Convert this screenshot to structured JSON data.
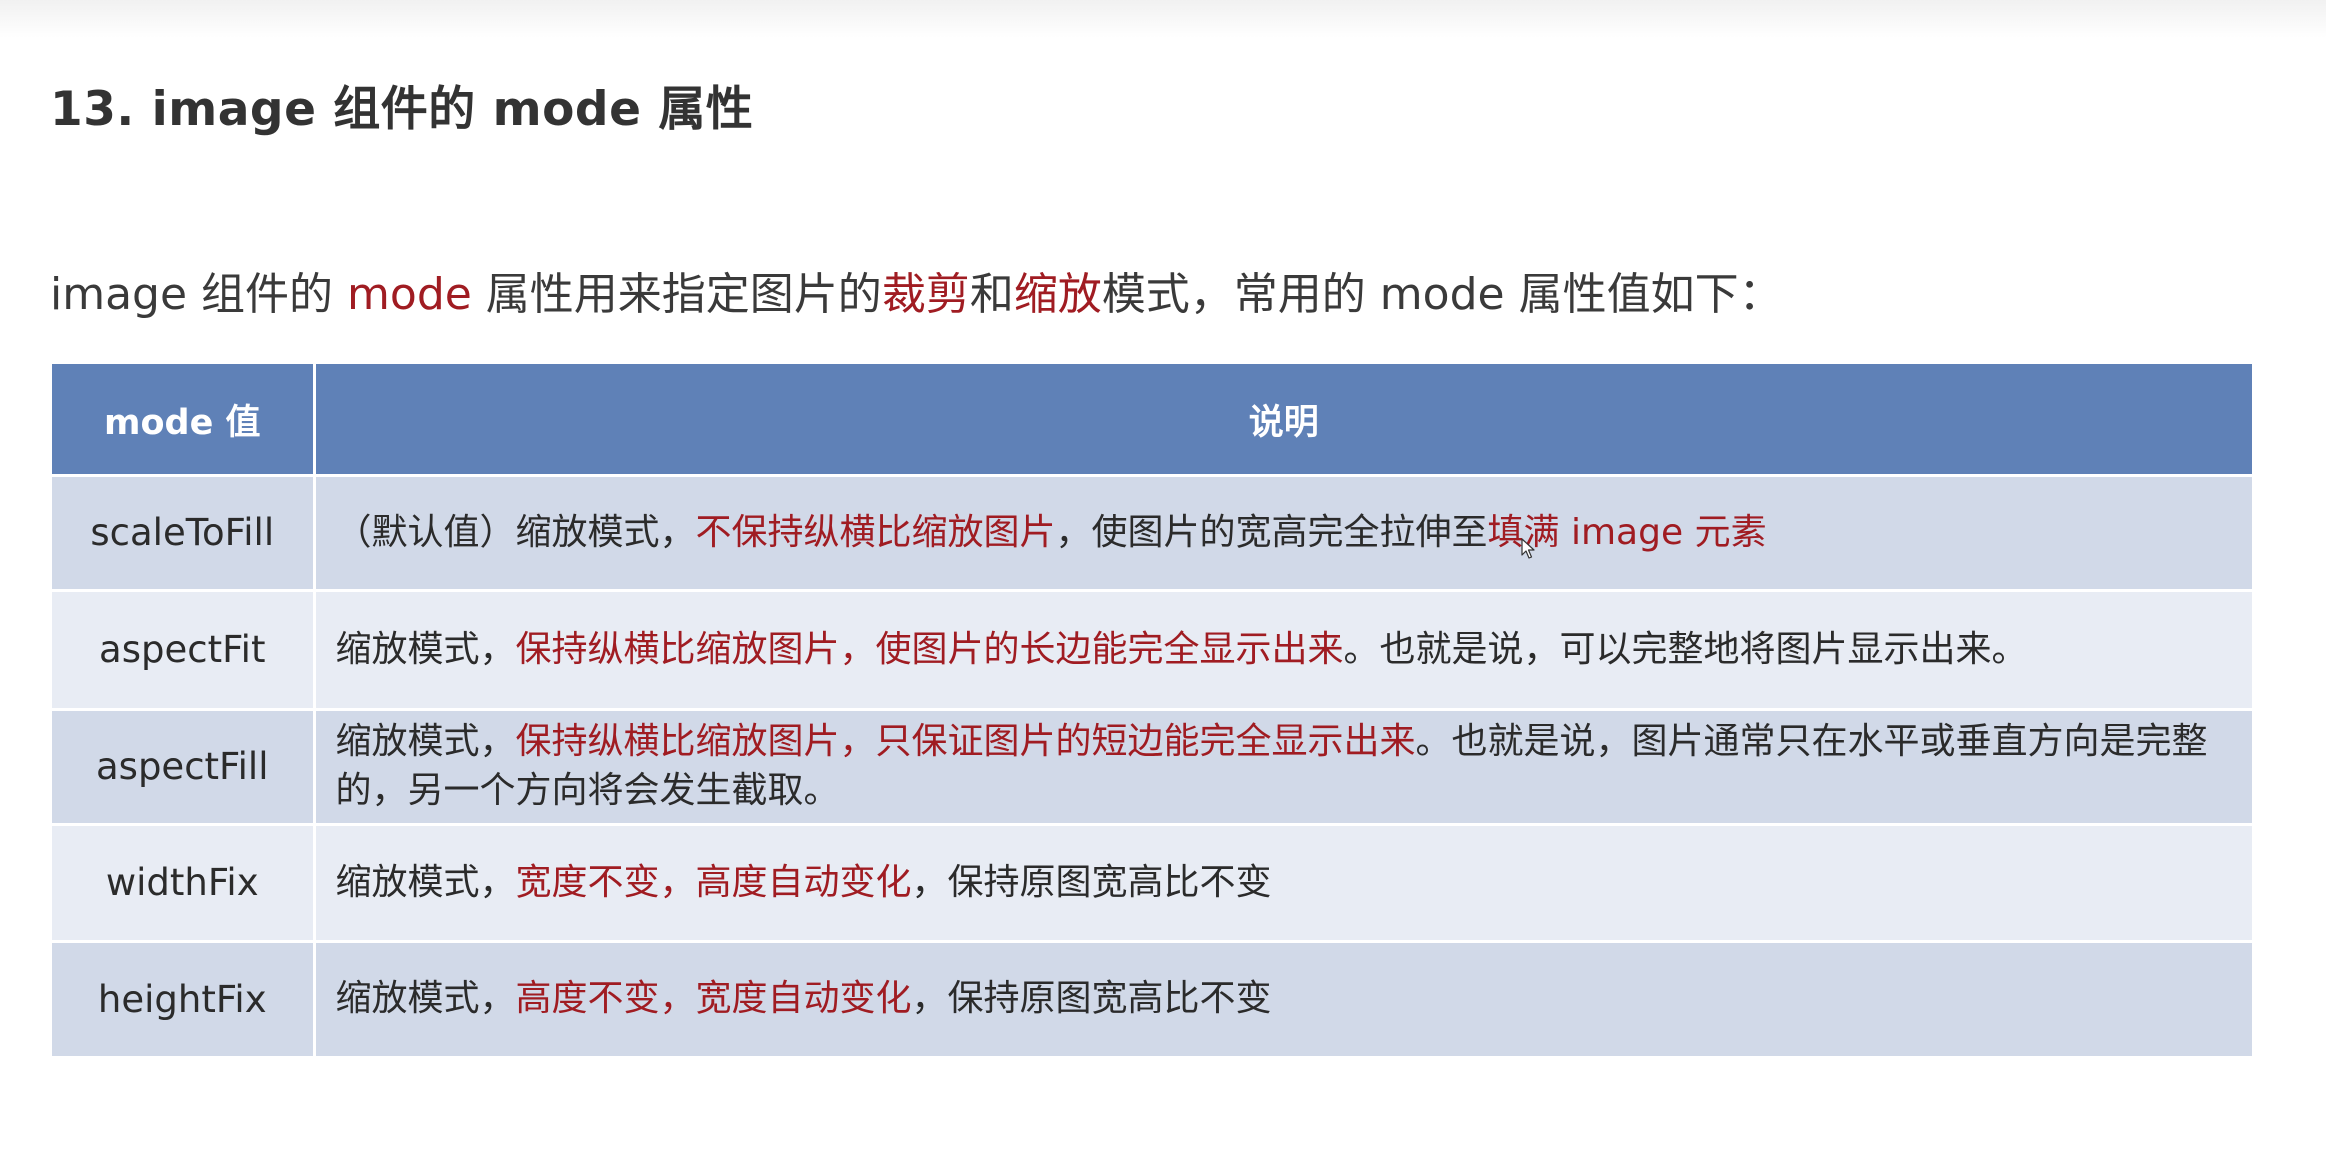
{
  "title": "13. image 组件的 mode 属性",
  "intro": {
    "p1": "image 组件的 ",
    "h1": "mode",
    "p2": " 属性用来指定图片的",
    "h2": "裁剪",
    "p3": "和",
    "h3": "缩放",
    "p4": "模式，常用的 mode 属性值如下："
  },
  "table": {
    "headers": [
      "mode 值",
      "说明"
    ],
    "rows": [
      {
        "mode": "scaleToFill",
        "d1": "（默认值）缩放模式，",
        "h1": "不保持纵横比缩放图片",
        "d2": "，使图片的宽高完全拉伸至",
        "h2": "填满 image 元素",
        "d3": ""
      },
      {
        "mode": "aspectFit",
        "d1": "缩放模式，",
        "h1": "保持纵横比缩放图片，使图片的长边能完全显示出来",
        "d2": "。也就是说，可以完整地将图片显示出来。",
        "h2": "",
        "d3": ""
      },
      {
        "mode": "aspectFill",
        "d1": "缩放模式，",
        "h1": "保持纵横比缩放图片，只保证图片的短边能完全显示出来",
        "d2": "。也就是说，图片通常只在水平或垂直方向是完整的，另一个方向将会发生截取。",
        "h2": "",
        "d3": ""
      },
      {
        "mode": "widthFix",
        "d1": "缩放模式，",
        "h1": "宽度不变，高度自动变化",
        "d2": "，保持原图宽高比不变",
        "h2": "",
        "d3": ""
      },
      {
        "mode": "heightFix",
        "d1": "缩放模式，",
        "h1": "高度不变，宽度自动变化",
        "d2": "，保持原图宽高比不变",
        "h2": "",
        "d3": ""
      }
    ]
  },
  "colors": {
    "highlight": "#a01c22",
    "header_bg": "#5f81b7",
    "row_dark": "#d1d9e8",
    "row_light": "#e8ecf4"
  },
  "icons": {
    "cursor": "mouse-pointer-icon"
  }
}
